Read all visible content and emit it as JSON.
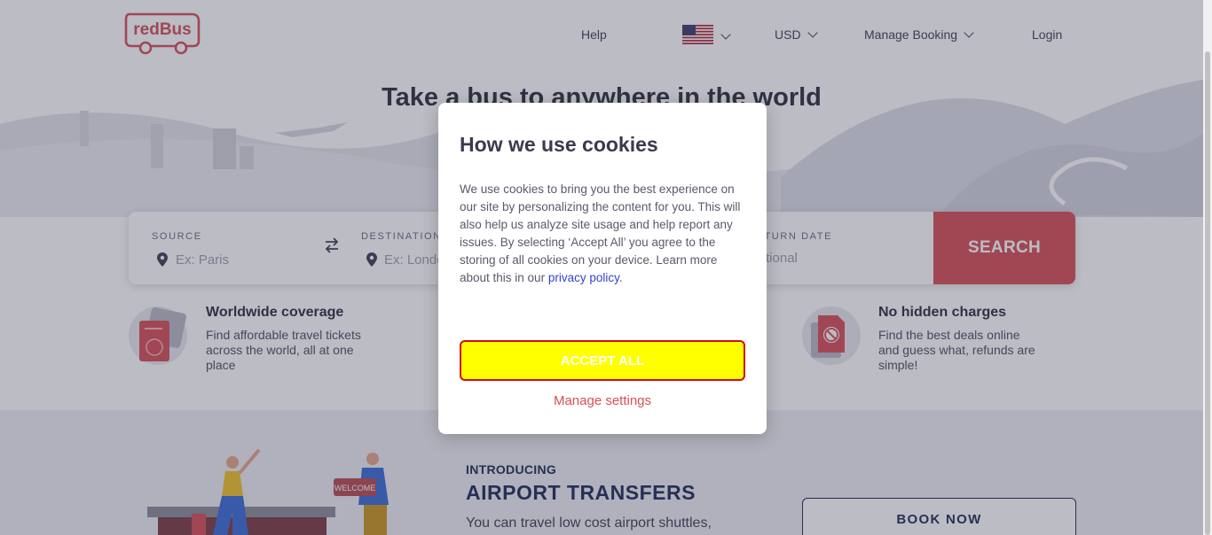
{
  "header": {
    "logo_text": "redBus",
    "nav": {
      "help": "Help",
      "currency": "USD",
      "manage_booking": "Manage Booking",
      "login": "Login"
    }
  },
  "hero": {
    "title": "Take a bus to anywhere in the world"
  },
  "search": {
    "source_label": "SOURCE",
    "source_placeholder": "Ex: Paris",
    "destination_label": "DESTINATION",
    "destination_placeholder": "Ex: London",
    "return_label": "RETURN DATE",
    "return_placeholder": "Optional",
    "search_button": "SEARCH"
  },
  "features": [
    {
      "title": "Worldwide coverage",
      "desc": [
        "Find affordable travel tickets",
        "across the world, all at one",
        "place"
      ],
      "icon": "passport-icon"
    },
    {
      "title": "No hidden charges",
      "desc": [
        "Find the best deals online",
        "and guess what, refunds are",
        "simple!"
      ],
      "icon": "no-charges-icon"
    }
  ],
  "promo": {
    "intro": "INTRODUCING",
    "title": "AIRPORT TRANSFERS",
    "desc": "You can travel low cost airport shuttles,",
    "welcome_sign": "WELCOME",
    "book_button": "BOOK NOW"
  },
  "cookie_modal": {
    "title": "How we use cookies",
    "body": "We use cookies to bring you the best experience on our site by personalizing the content for you. This will also help us analyze site usage and help report any issues. By selecting ‘Accept All’ you agree to the storing of all cookies on your device. Learn more about this in our",
    "link_text": "privacy policy",
    "link_suffix": ".",
    "accept_button": "ACCEPT ALL",
    "manage_link": "Manage settings"
  },
  "colors": {
    "brand_red": "#d84e55",
    "navy": "#1e2a55",
    "accept_bg": "#ffff00",
    "accept_border": "#d10a1a"
  }
}
